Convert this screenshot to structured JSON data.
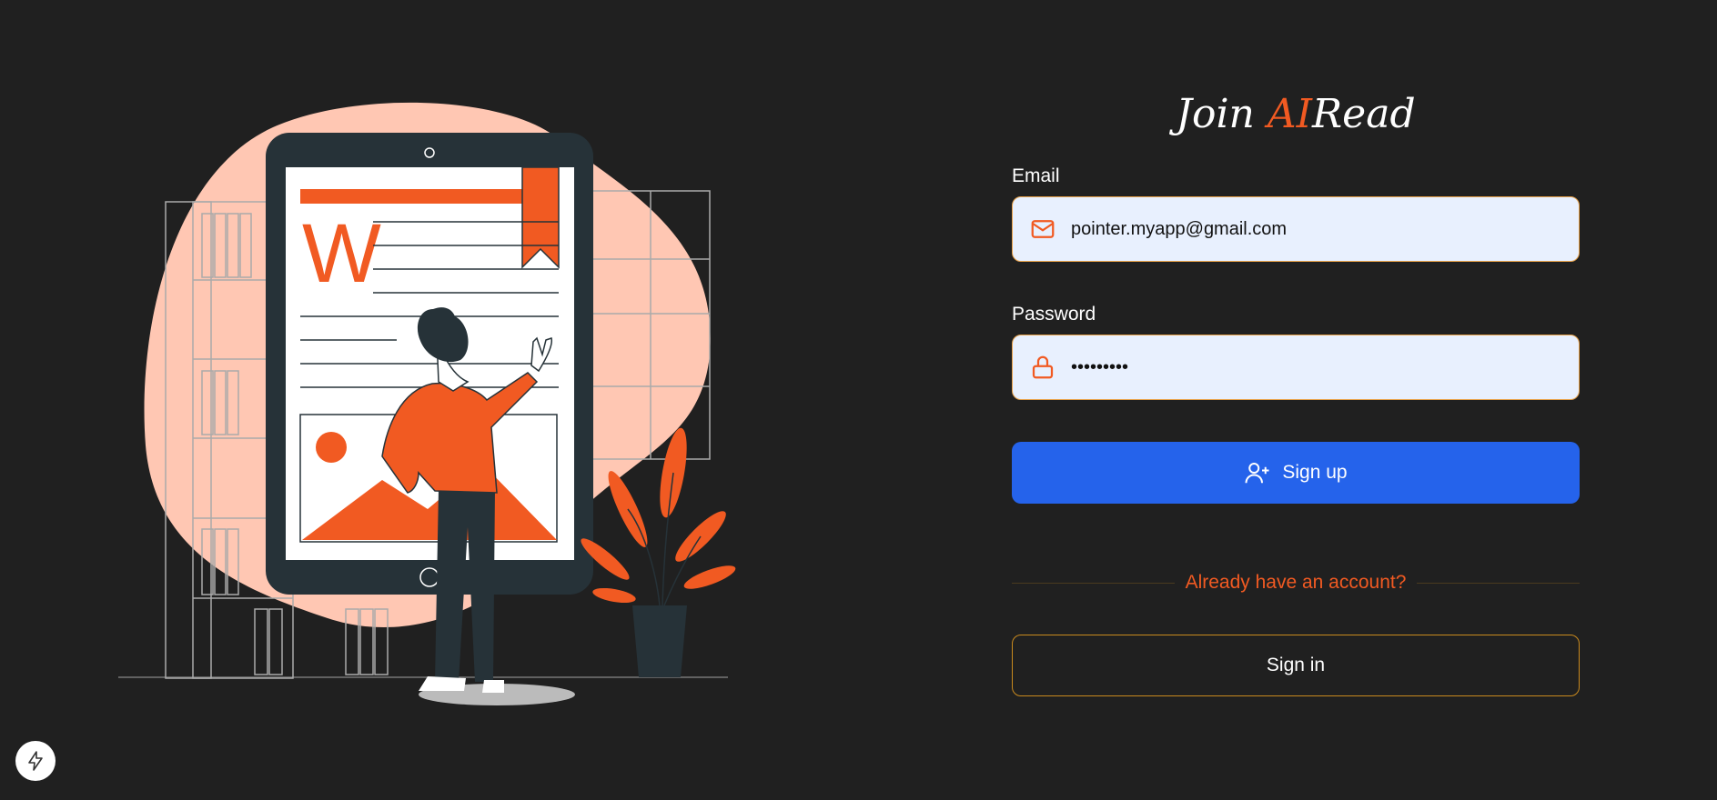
{
  "hero": {
    "title_prefix": "Join ",
    "title_accent": "AI",
    "title_suffix": "Read",
    "letter": "W"
  },
  "form": {
    "email_label": "Email",
    "email_value": "pointer.myapp@gmail.com",
    "email_icon": "mail-icon",
    "password_label": "Password",
    "password_value": "•••••••••",
    "password_icon": "lock-icon",
    "signup_label": "Sign up",
    "signup_icon": "user-plus-icon",
    "divider_text": "Already have an account?",
    "signin_label": "Sign in"
  },
  "colors": {
    "background": "#202020",
    "accent": "#f15a22",
    "primary_button": "#2563eb",
    "input_bg": "#e8f0fe"
  }
}
